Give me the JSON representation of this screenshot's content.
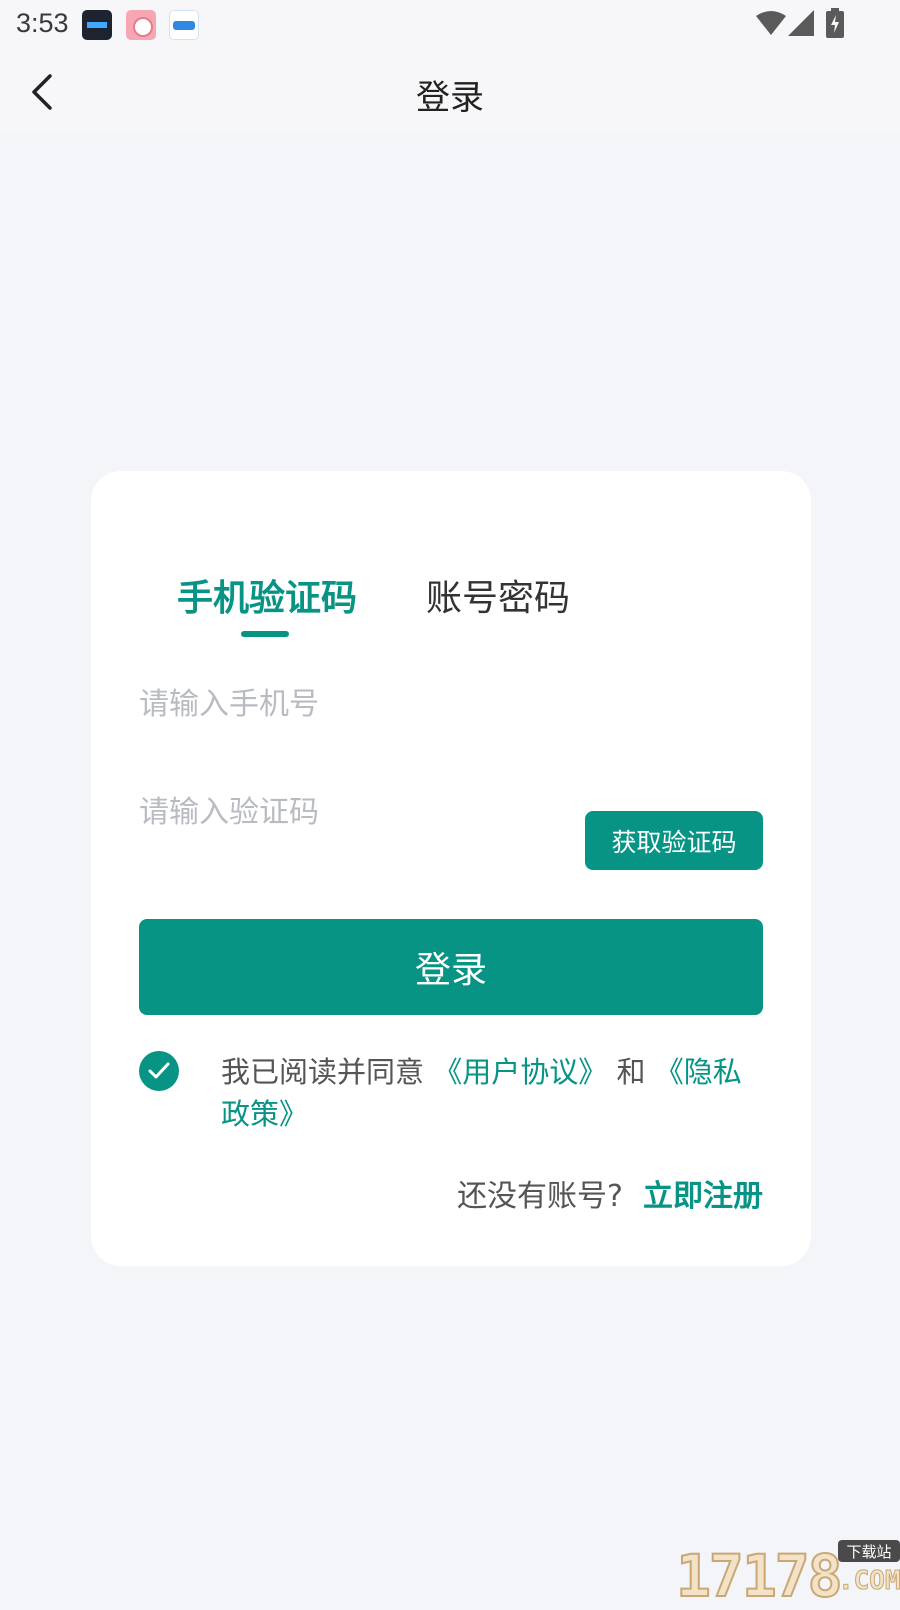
{
  "status_bar": {
    "time": "3:53",
    "icons": [
      "clock-widget-app-icon",
      "rice-bowl-app-icon",
      "blue-app-icon",
      "wifi-icon",
      "signal-icon",
      "battery-charging-icon"
    ]
  },
  "header": {
    "title": "登录",
    "back_icon": "chevron-left-icon"
  },
  "tabs": [
    {
      "label": "手机验证码",
      "active": true
    },
    {
      "label": "账号密码",
      "active": false
    }
  ],
  "form": {
    "phone_placeholder": "请输入手机号",
    "code_placeholder": "请输入验证码",
    "get_code_label": "获取验证码",
    "login_label": "登录"
  },
  "agreement": {
    "checked": true,
    "prefix": "我已阅读并同意",
    "user_agreement": "《用户协议》",
    "and": "和",
    "privacy_policy": "《隐私政策》"
  },
  "register": {
    "prompt": "还没有账号?",
    "link": "立即注册"
  },
  "watermark": {
    "digits": "17178",
    "badge": "下载站",
    "suffix": ".COM"
  },
  "colors": {
    "accent": "#079485",
    "background": "#f4f5f8",
    "card": "#ffffff",
    "placeholder": "#b8bbc2"
  }
}
